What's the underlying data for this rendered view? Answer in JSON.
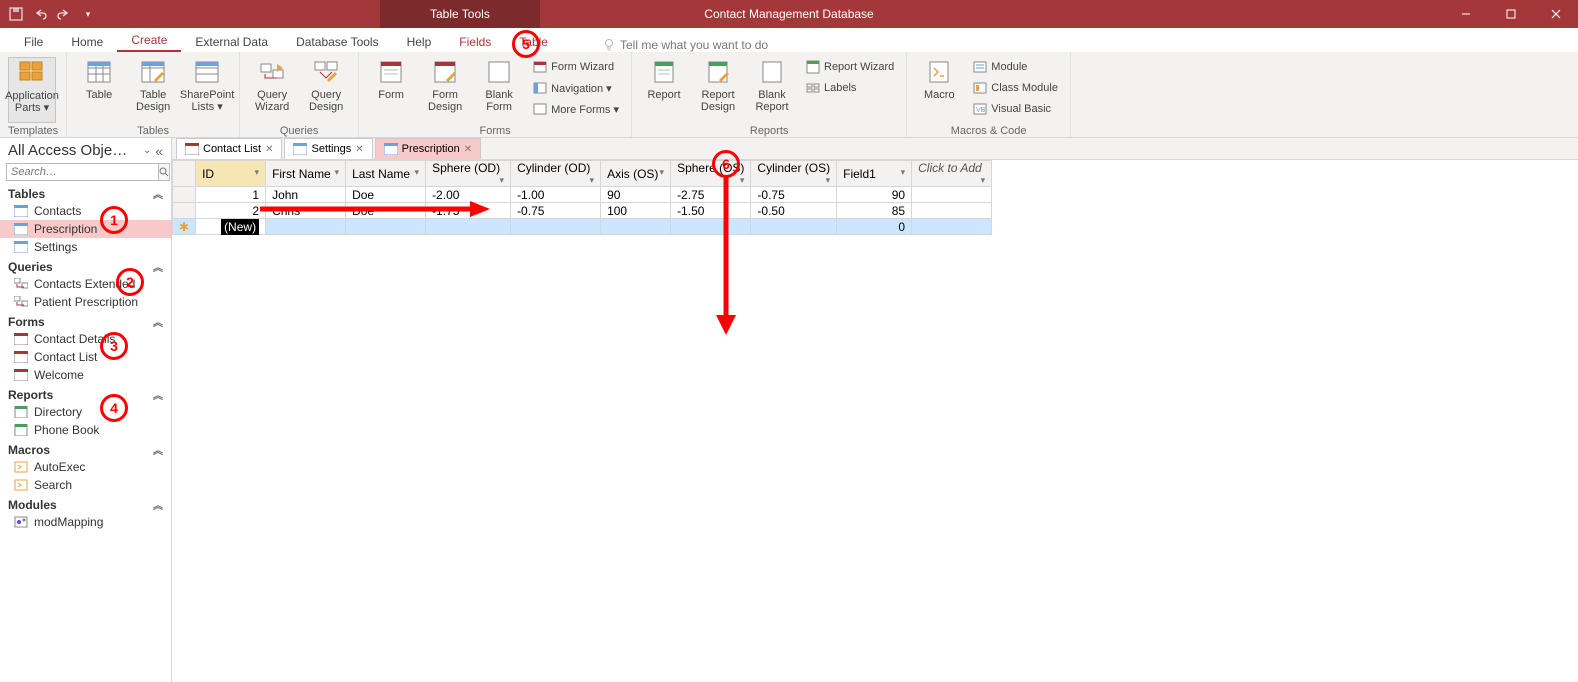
{
  "titlebar": {
    "table_tools": "Table Tools",
    "app_title": "Contact Management Database"
  },
  "ribbon_tabs": {
    "file": "File",
    "home": "Home",
    "create": "Create",
    "external_data": "External Data",
    "database_tools": "Database Tools",
    "help": "Help",
    "fields": "Fields",
    "table": "Table",
    "tell_me": "Tell me what you want to do"
  },
  "ribbon": {
    "templates": {
      "label": "Templates",
      "application_parts": "Application\nParts ▾"
    },
    "tables": {
      "label": "Tables",
      "table": "Table",
      "table_design": "Table\nDesign",
      "sharepoint_lists": "SharePoint\nLists ▾"
    },
    "queries": {
      "label": "Queries",
      "query_wizard": "Query\nWizard",
      "query_design": "Query\nDesign"
    },
    "forms": {
      "label": "Forms",
      "form": "Form",
      "form_design": "Form\nDesign",
      "blank_form": "Blank\nForm",
      "form_wizard": "Form Wizard",
      "navigation": "Navigation ▾",
      "more_forms": "More Forms ▾"
    },
    "reports": {
      "label": "Reports",
      "report": "Report",
      "report_design": "Report\nDesign",
      "blank_report": "Blank\nReport",
      "report_wizard": "Report Wizard",
      "labels": "Labels"
    },
    "macros": {
      "label": "Macros & Code",
      "macro": "Macro",
      "module": "Module",
      "class_module": "Class Module",
      "visual_basic": "Visual Basic"
    }
  },
  "nav": {
    "title": "All Access Obje…",
    "search_placeholder": "Search…",
    "groups": {
      "tables": {
        "label": "Tables",
        "items": [
          "Contacts",
          "Prescription",
          "Settings"
        ]
      },
      "queries": {
        "label": "Queries",
        "items": [
          "Contacts Extended",
          "Patient Prescription"
        ]
      },
      "forms": {
        "label": "Forms",
        "items": [
          "Contact Details",
          "Contact List",
          "Welcome"
        ]
      },
      "reports": {
        "label": "Reports",
        "items": [
          "Directory",
          "Phone Book"
        ]
      },
      "macros": {
        "label": "Macros",
        "items": [
          "AutoExec",
          "Search"
        ]
      },
      "modules": {
        "label": "Modules",
        "items": [
          "modMapping"
        ]
      }
    }
  },
  "doc_tabs": [
    "Contact List",
    "Settings",
    "Prescription"
  ],
  "table": {
    "columns": [
      "ID",
      "First Name",
      "Last Name",
      "Sphere (OD)",
      "Cylinder (OD)",
      "Axis (OS)",
      "Sphere (OS)",
      "Cylinder (OS)",
      "Field1",
      "Click to Add"
    ],
    "rows": [
      {
        "id": "1",
        "first": "John",
        "last": "Doe",
        "sph_od": "-2.00",
        "cyl_od": "-1.00",
        "axis_os": "90",
        "sph_os": "-2.75",
        "cyl_os": "-0.75",
        "field1": "90"
      },
      {
        "id": "2",
        "first": "Chris",
        "last": "Doe",
        "sph_od": "-1.75",
        "cyl_od": "-0.75",
        "axis_os": "100",
        "sph_os": "-1.50",
        "cyl_os": "-0.50",
        "field1": "85"
      }
    ],
    "new_label": "(New)",
    "new_field1": "0"
  },
  "annotations": {
    "1": "1",
    "2": "2",
    "3": "3",
    "4": "4",
    "5": "5",
    "6": "6"
  }
}
